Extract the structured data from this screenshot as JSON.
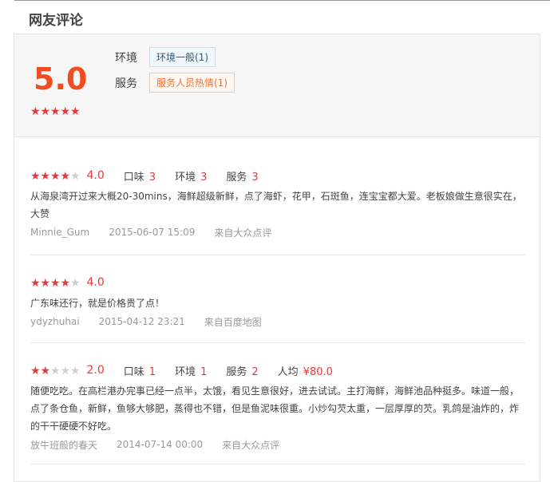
{
  "section": {
    "title": "网友评论"
  },
  "summary": {
    "score": "5.0",
    "stars": 5,
    "tags": [
      {
        "label": "环境",
        "tag": "环境一般(1)",
        "kind": "env"
      },
      {
        "label": "服务",
        "tag": "服务人员热情(1)",
        "kind": "svc"
      }
    ]
  },
  "reviews": [
    {
      "stars": 4,
      "score": "4.0",
      "subs": [
        {
          "label": "口味",
          "value": "3"
        },
        {
          "label": "环境",
          "value": "3"
        },
        {
          "label": "服务",
          "value": "3"
        }
      ],
      "text": "从海泉湾开过来大概20-30mins，海鲜超级新鲜，点了海虾，花甲，石斑鱼，连宝宝都大爱。老板娘做生意很实在，大赞",
      "user": "Minnie_Gum",
      "date": "2015-06-07 15:09",
      "source": "来自大众点评"
    },
    {
      "stars": 4,
      "score": "4.0",
      "subs": [],
      "text": "广东味还行，就是价格贵了点！",
      "user": "ydyzhuhai",
      "date": "2015-04-12 23:21",
      "source": "来自百度地图"
    },
    {
      "stars": 2,
      "score": "2.0",
      "subs": [
        {
          "label": "口味",
          "value": "1"
        },
        {
          "label": "环境",
          "value": "1"
        },
        {
          "label": "服务",
          "value": "2"
        },
        {
          "label": "人均",
          "value": "¥80.0"
        }
      ],
      "text": "随便吃吃。在高栏港办完事已经一点半，太饿，看见生意很好，进去试试。主打海鲜，海鲜池品种挺多。味道一般，点了条仓鱼，新鲜，鱼够大够肥，蒸得也不错，但是鱼泥味很重。小炒勾芡太重，一层厚厚的芡。乳鸽是油炸的，炸的干干硬硬不好吃。",
      "user": "放牛班般的春天",
      "date": "2014-07-14 00:00",
      "source": "来自大众点评"
    }
  ]
}
